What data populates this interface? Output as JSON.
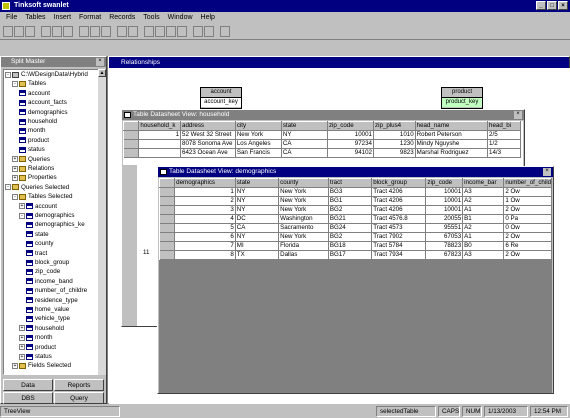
{
  "app": {
    "title": "Tinksoft swanlet"
  },
  "menu": [
    "File",
    "Tables",
    "Insert",
    "Format",
    "Records",
    "Tools",
    "Window",
    "Help"
  ],
  "toolbar_icons": [
    "new-icon",
    "open-icon",
    "save-icon",
    "",
    "cut-icon",
    "copy-icon",
    "paste-icon",
    "",
    "sort-icon",
    "filter-icon",
    "find-icon",
    "",
    "run-icon",
    "stop-icon",
    "",
    "table-icon",
    "query-icon",
    "form-icon",
    "report-icon",
    "",
    "relationships-icon",
    "properties-icon",
    "",
    "help-icon"
  ],
  "split": {
    "title": "Split Master",
    "tree": [
      {
        "label": "C:\\WDesignData\\Hybrid",
        "level": 0,
        "icon": "db",
        "exp": "-"
      },
      {
        "label": "Tables",
        "level": 1,
        "icon": "folder",
        "exp": "-"
      },
      {
        "label": "account",
        "level": 2,
        "icon": "table"
      },
      {
        "label": "account_facts",
        "level": 2,
        "icon": "table"
      },
      {
        "label": "demographics",
        "level": 2,
        "icon": "table"
      },
      {
        "label": "household",
        "level": 2,
        "icon": "table"
      },
      {
        "label": "month",
        "level": 2,
        "icon": "table"
      },
      {
        "label": "product",
        "level": 2,
        "icon": "table"
      },
      {
        "label": "status",
        "level": 2,
        "icon": "table"
      },
      {
        "label": "Queries",
        "level": 1,
        "icon": "folder",
        "exp": "+"
      },
      {
        "label": "Relations",
        "level": 1,
        "icon": "folder",
        "exp": "+"
      },
      {
        "label": "Properties",
        "level": 1,
        "icon": "folder",
        "exp": "+"
      },
      {
        "label": "Queries Selected",
        "level": 0,
        "icon": "folder",
        "exp": "-"
      },
      {
        "label": "Tables Selected",
        "level": 1,
        "icon": "folder",
        "exp": "-"
      },
      {
        "label": "account",
        "level": 2,
        "icon": "table",
        "exp": "+"
      },
      {
        "label": "demographics",
        "level": 2,
        "icon": "table",
        "exp": "-"
      },
      {
        "label": "demographics_ke",
        "level": 3,
        "icon": "table"
      },
      {
        "label": "state",
        "level": 3,
        "icon": "table"
      },
      {
        "label": "county",
        "level": 3,
        "icon": "table"
      },
      {
        "label": "tract",
        "level": 3,
        "icon": "table"
      },
      {
        "label": "block_group",
        "level": 3,
        "icon": "table"
      },
      {
        "label": "zip_code",
        "level": 3,
        "icon": "table"
      },
      {
        "label": "income_band",
        "level": 3,
        "icon": "table"
      },
      {
        "label": "number_of_childre",
        "level": 3,
        "icon": "table"
      },
      {
        "label": "residence_type",
        "level": 3,
        "icon": "table"
      },
      {
        "label": "home_value",
        "level": 3,
        "icon": "table"
      },
      {
        "label": "vehicle_type",
        "level": 3,
        "icon": "table"
      },
      {
        "label": "household",
        "level": 2,
        "icon": "table",
        "exp": "+"
      },
      {
        "label": "month",
        "level": 2,
        "icon": "table",
        "exp": "+"
      },
      {
        "label": "product",
        "level": 2,
        "icon": "table",
        "exp": "+"
      },
      {
        "label": "status",
        "level": 2,
        "icon": "table",
        "exp": "+"
      },
      {
        "label": "Fields Selected",
        "level": 1,
        "icon": "folder",
        "exp": "+"
      }
    ],
    "tabs": [
      "Data",
      "Reports",
      "DBS",
      "Query"
    ]
  },
  "relationships": {
    "title": "Relationships",
    "entities": [
      {
        "name": "account",
        "key": "account_key"
      },
      {
        "name": "product",
        "key": "product_key"
      }
    ]
  },
  "household_view": {
    "title": "Table Datasheet View: household",
    "columns": [
      "household_k",
      "address",
      "city",
      "state",
      "zip_code",
      "zip_plus4",
      "head_name",
      "head_bi"
    ],
    "rows": [
      [
        "1",
        "52 West 32 Street",
        "New York",
        "NY",
        "10001",
        "1010",
        "Robert Peterson",
        "2/5"
      ],
      [
        "",
        "8078 Sonoma Ave",
        "Los Angeles",
        "CA",
        "97234",
        "1230",
        "Mindy Nguyshe",
        "1/2"
      ],
      [
        "",
        "6423 Ocean Ave",
        "San Francis",
        "CA",
        "94102",
        "9823",
        "Marshal Rodriguez",
        "14/3"
      ]
    ],
    "left_row_num": "11"
  },
  "demographics_view": {
    "title": "Table Datasheet View: demographics",
    "columns": [
      "demographics",
      "state",
      "county",
      "tract",
      "block_group",
      "zip_code",
      "income_bar",
      "number_of_childre"
    ],
    "rows": [
      [
        "1",
        "NY",
        "New York",
        "BG3",
        "Tract 4206",
        "10001",
        "A3",
        "2 Ow"
      ],
      [
        "2",
        "NY",
        "New York",
        "BG1",
        "Tract 4206",
        "10001",
        "A2",
        "1 Ow"
      ],
      [
        "3",
        "NY",
        "New York",
        "BG2",
        "Tract 4206",
        "10001",
        "A1",
        "2 Ow"
      ],
      [
        "4",
        "DC",
        "Washington",
        "BG21",
        "Tract 4576.8",
        "20055",
        "B1",
        "0 Pa"
      ],
      [
        "5",
        "CA",
        "Sacramento",
        "BG24",
        "Tract 4573",
        "95551",
        "A2",
        "0 Ow"
      ],
      [
        "6",
        "NY",
        "New York",
        "BG2",
        "Tract 7902",
        "67053",
        "A1",
        "2 Ow"
      ],
      [
        "7",
        "MI",
        "Florida",
        "BG18",
        "Tract 5784",
        "78823",
        "B0",
        "6 Re"
      ],
      [
        "8",
        "TX",
        "Dallas",
        "BG17",
        "Tract 7934",
        "67823",
        "A3",
        "2 Ow"
      ]
    ]
  },
  "status": {
    "left": "TreeView",
    "cells": [
      "selectedTable",
      "CAPS",
      "NUM",
      "1/13/2003",
      "12:54 PM"
    ]
  }
}
